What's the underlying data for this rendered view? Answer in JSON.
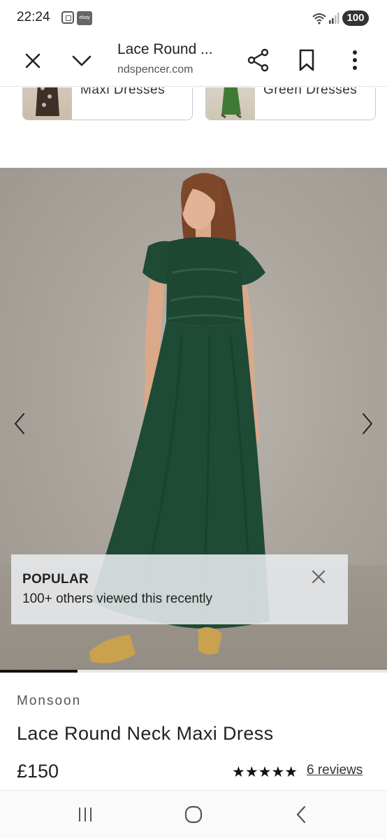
{
  "status_bar": {
    "time": "22:24",
    "battery": "100",
    "ebay_badge": "ebay"
  },
  "toolbar": {
    "page_title": "Lace Round ...",
    "url": "ndspencer.com"
  },
  "related_categories": [
    {
      "label": "Maxi Dresses"
    },
    {
      "label": "Green Dresses"
    }
  ],
  "gallery": {
    "popular_title": "POPULAR",
    "popular_text": "100+ others viewed this recently",
    "progress": 0.2
  },
  "product": {
    "brand": "Monsoon",
    "name": "Lace Round Neck Maxi Dress",
    "price": "£150",
    "rating_stars": "★★★★★",
    "reviews_label": "6 reviews"
  },
  "colors": {
    "dress_green": "#1f4a36",
    "background_grey": "#aba59d",
    "gold_shoes": "#c9a24e"
  }
}
